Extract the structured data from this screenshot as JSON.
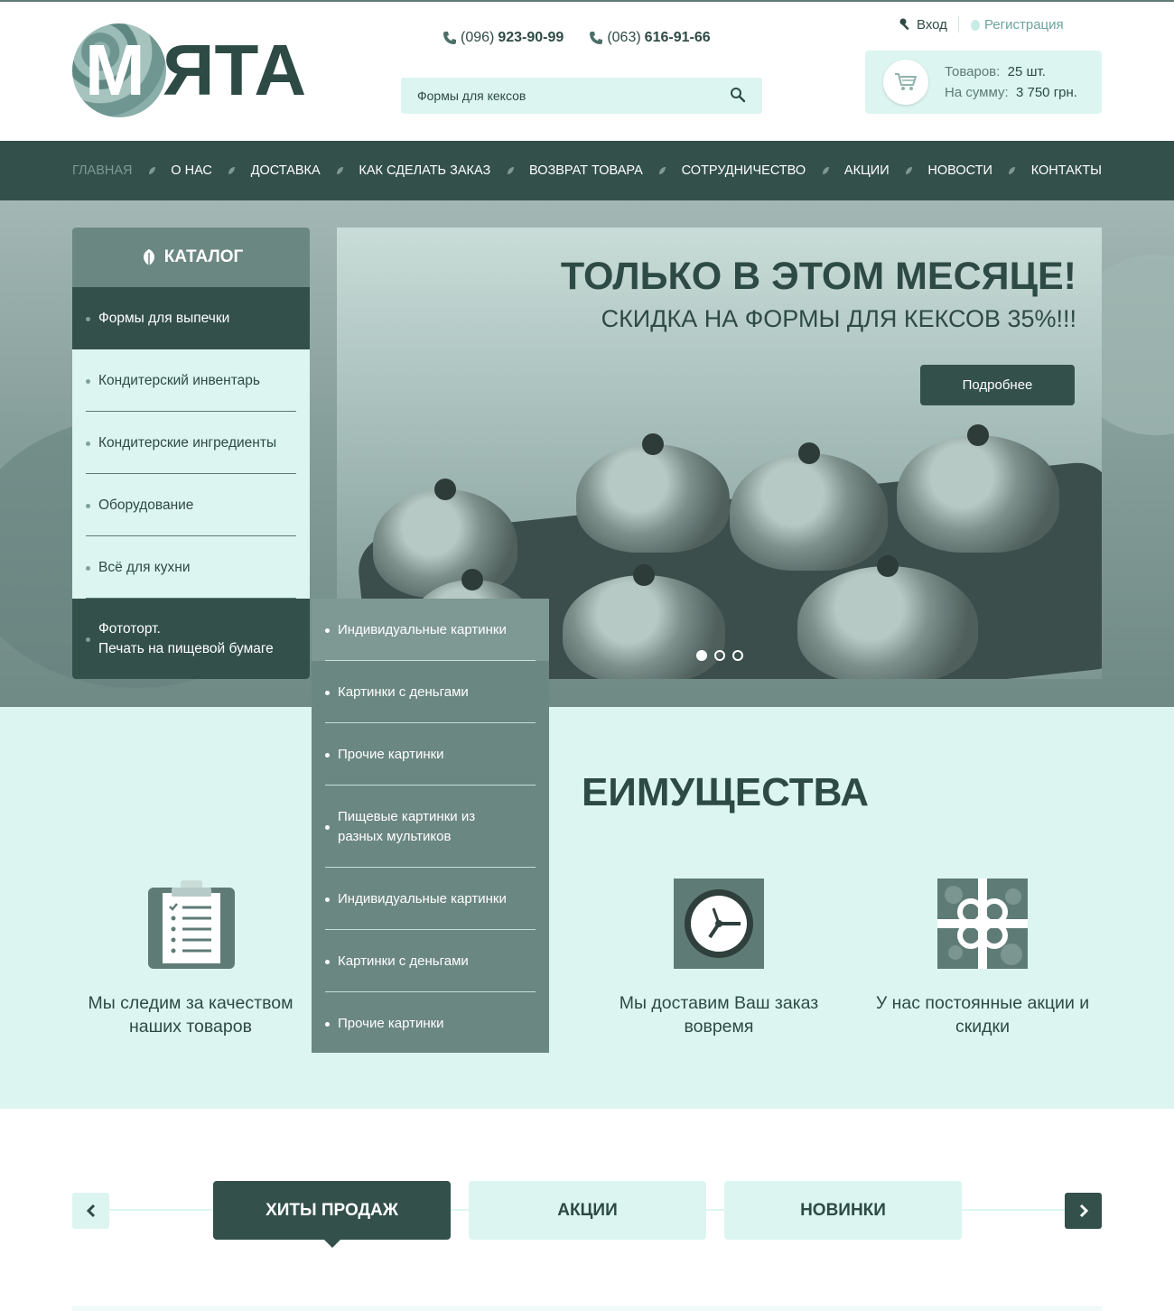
{
  "header": {
    "logo": {
      "first_letter": "М",
      "rest": "ЯТА"
    },
    "phones": [
      {
        "code": "(096)",
        "number": "923-90-99"
      },
      {
        "code": "(063)",
        "number": "616-91-66"
      }
    ],
    "search": {
      "value": "Формы для кексов",
      "placeholder": "Формы для кексов"
    },
    "auth": {
      "login": "Вход",
      "register": "Регистрация"
    },
    "cart": {
      "items_label": "Товаров:",
      "items_value": "25 шт.",
      "sum_label": "На сумму:",
      "sum_value": "3 750 грн."
    }
  },
  "nav": {
    "items": [
      "ГЛАВНАЯ",
      "О НАС",
      "ДОСТАВКА",
      "КАК СДЕЛАТЬ ЗАКАЗ",
      "ВОЗВРАТ ТОВАРА",
      "СОТРУДНИЧЕСТВО",
      "АКЦИИ",
      "НОВОСТИ",
      "КОНТАКТЫ"
    ]
  },
  "catalog": {
    "title": "КАТАЛОГ",
    "items": [
      "Формы для выпечки",
      "Кондитерский инвентарь",
      "Кондитерские ингредиенты",
      "Оборудование",
      "Всё для кухни",
      "Фототорт.\nПечать на пищевой бумаге"
    ],
    "submenu": [
      "Индивидуальные картинки",
      "Картинки с деньгами",
      "Прочие картинки",
      "Пищевые картинки из разных мультиков",
      "Индивидуальные картинки",
      "Картинки с деньгами",
      "Прочие картинки"
    ]
  },
  "slider": {
    "title": "ТОЛЬКО В ЭТОМ МЕСЯЦЕ!",
    "subtitle": "СКИДКА НА ФОРМЫ ДЛЯ КЕКСОВ 35%!!!",
    "button": "Подробнее",
    "slides_total": 3,
    "active_slide": 1
  },
  "advantages": {
    "title": "ПРЕИМУЩЕСТВА",
    "visible_title": "ЕИМУЩЕСТВА",
    "items": [
      {
        "icon": "clipboard-icon",
        "text": "Мы следим за качеством наших товаров"
      },
      {
        "icon": "clock-icon",
        "text": "Мы доставим Ваш заказ вовремя"
      },
      {
        "icon": "gift-icon",
        "text": "У нас постоянные акции и скидки"
      }
    ]
  },
  "tabs": {
    "items": [
      "ХИТЫ ПРОДАЖ",
      "АКЦИИ",
      "НОВИНКИ"
    ],
    "active": 0
  },
  "colors": {
    "dark": "#33504b",
    "mint": "#dcf5f0",
    "mid": "#6b8782",
    "accent_text": "#2e4a45"
  }
}
